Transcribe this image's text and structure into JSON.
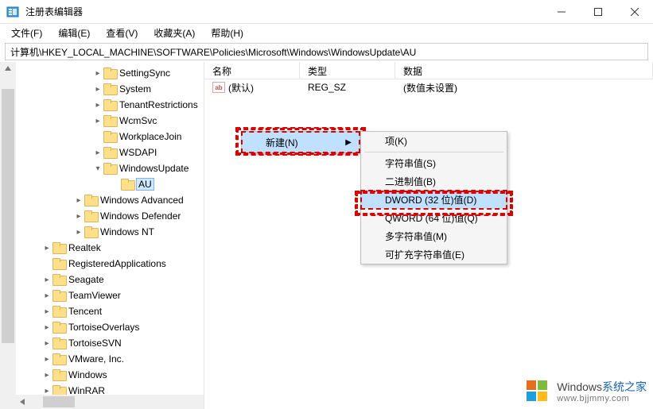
{
  "window": {
    "title": "注册表编辑器"
  },
  "menu": {
    "file": "文件(F)",
    "edit": "编辑(E)",
    "view": "查看(V)",
    "favorites": "收藏夹(A)",
    "help": "帮助(H)"
  },
  "address": "计算机\\HKEY_LOCAL_MACHINE\\SOFTWARE\\Policies\\Microsoft\\Windows\\WindowsUpdate\\AU",
  "tree": {
    "items": [
      {
        "indent": 96,
        "twist": ">",
        "label": "SettingSync"
      },
      {
        "indent": 96,
        "twist": ">",
        "label": "System"
      },
      {
        "indent": 96,
        "twist": ">",
        "label": "TenantRestrictions"
      },
      {
        "indent": 96,
        "twist": ">",
        "label": "WcmSvc"
      },
      {
        "indent": 96,
        "twist": "",
        "label": "WorkplaceJoin"
      },
      {
        "indent": 96,
        "twist": ">",
        "label": "WSDAPI"
      },
      {
        "indent": 96,
        "twist": "v",
        "label": "WindowsUpdate"
      },
      {
        "indent": 118,
        "twist": "",
        "label": "AU",
        "selected": true
      },
      {
        "indent": 72,
        "twist": ">",
        "label": "Windows Advanced"
      },
      {
        "indent": 72,
        "twist": ">",
        "label": "Windows Defender"
      },
      {
        "indent": 72,
        "twist": ">",
        "label": "Windows NT"
      },
      {
        "indent": 32,
        "twist": ">",
        "label": "Realtek"
      },
      {
        "indent": 32,
        "twist": "",
        "label": "RegisteredApplications"
      },
      {
        "indent": 32,
        "twist": ">",
        "label": "Seagate"
      },
      {
        "indent": 32,
        "twist": ">",
        "label": "TeamViewer"
      },
      {
        "indent": 32,
        "twist": ">",
        "label": "Tencent"
      },
      {
        "indent": 32,
        "twist": ">",
        "label": "TortoiseOverlays"
      },
      {
        "indent": 32,
        "twist": ">",
        "label": "TortoiseSVN"
      },
      {
        "indent": 32,
        "twist": ">",
        "label": "VMware, Inc."
      },
      {
        "indent": 32,
        "twist": ">",
        "label": "Windows"
      },
      {
        "indent": 32,
        "twist": ">",
        "label": "WinRAR"
      }
    ]
  },
  "columns": {
    "name": "名称",
    "type": "类型",
    "data": "数据"
  },
  "values": [
    {
      "icon": "ab",
      "name": "(默认)",
      "type": "REG_SZ",
      "data": "(数值未设置)"
    }
  ],
  "context_new": {
    "label": "新建(N)",
    "arrow": "▶"
  },
  "context_sub": {
    "items": [
      {
        "label": "项(K)"
      },
      {
        "sep": true
      },
      {
        "label": "字符串值(S)"
      },
      {
        "label": "二进制值(B)"
      },
      {
        "label": "DWORD (32 位)值(D)",
        "highlight": true
      },
      {
        "label": "QWORD (64 位)值(Q)"
      },
      {
        "label": "多字符串值(M)"
      },
      {
        "label": "可扩充字符串值(E)"
      }
    ]
  },
  "watermark": {
    "brand_left": "Windows",
    "brand_right": "系统之家",
    "url": "www.bjjmmy.com"
  }
}
